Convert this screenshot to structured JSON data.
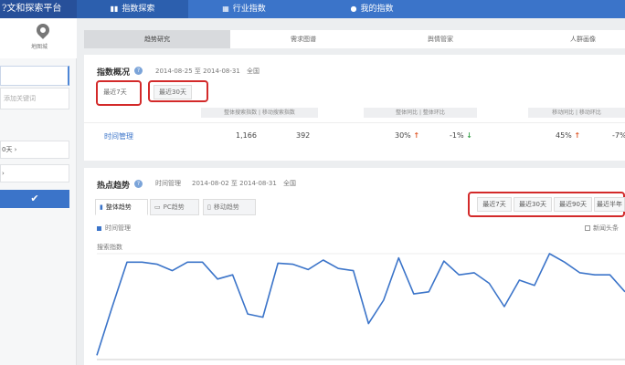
{
  "header": {
    "brand": "?文和探索平台",
    "nav": [
      {
        "label": "指数探索",
        "icon": "bar-chart-icon",
        "active": true
      },
      {
        "label": "行业指数",
        "icon": "grid-icon",
        "active": false
      },
      {
        "label": "我的指数",
        "icon": "user-icon",
        "active": false
      }
    ]
  },
  "sidebar": {
    "logo_label": "地图城",
    "keyword_placeholder": "添加关键词",
    "option_1": "0天 ›",
    "option_2": "›"
  },
  "main_tabs": [
    "趋势研究",
    "需求图谱",
    "舆情管家",
    "人群画像"
  ],
  "overview": {
    "title": "指数概况",
    "date_range": "2014-08-25 至 2014-08-31",
    "region": "全国",
    "range_tabs": [
      "最近7天",
      "最近30天"
    ],
    "col_headers": [
      "整体搜索指数 | 移动搜索指数",
      "整体同比 | 整体环比",
      "移动同比 | 移动环比"
    ],
    "row": {
      "keyword": "时间管理",
      "overall_index": "1,166",
      "mobile_index": "392",
      "overall_yoy": "30%",
      "overall_mom": "-1%",
      "mobile_yoy": "45%",
      "mobile_mom": "-7%"
    }
  },
  "trend": {
    "title": "热点趋势",
    "keyword": "时间管理",
    "date_range": "2014-08-02 至 2014-08-31",
    "region": "全国",
    "subtabs": [
      "整体趋势",
      "PC趋势",
      "移动趋势"
    ],
    "ranges": [
      "最近7天",
      "最近30天",
      "最近90天",
      "最近半年"
    ],
    "legend": "时间管理",
    "news_toggle": "新闻头条",
    "y_label": "搜索指数"
  },
  "chart_data": {
    "type": "line",
    "series": [
      {
        "name": "时间管理",
        "values": [
          0.04,
          0.49,
          0.92,
          0.92,
          0.9,
          0.84,
          0.92,
          0.92,
          0.76,
          0.8,
          0.43,
          0.4,
          0.91,
          0.9,
          0.85,
          0.94,
          0.86,
          0.84,
          0.34,
          0.56,
          0.96,
          0.62,
          0.64,
          0.93,
          0.8,
          0.82,
          0.72,
          0.5,
          0.75,
          0.7,
          1.0,
          0.92,
          0.82,
          0.8,
          0.8,
          0.64
        ]
      }
    ],
    "color": "#3b74c9",
    "grid": true
  }
}
